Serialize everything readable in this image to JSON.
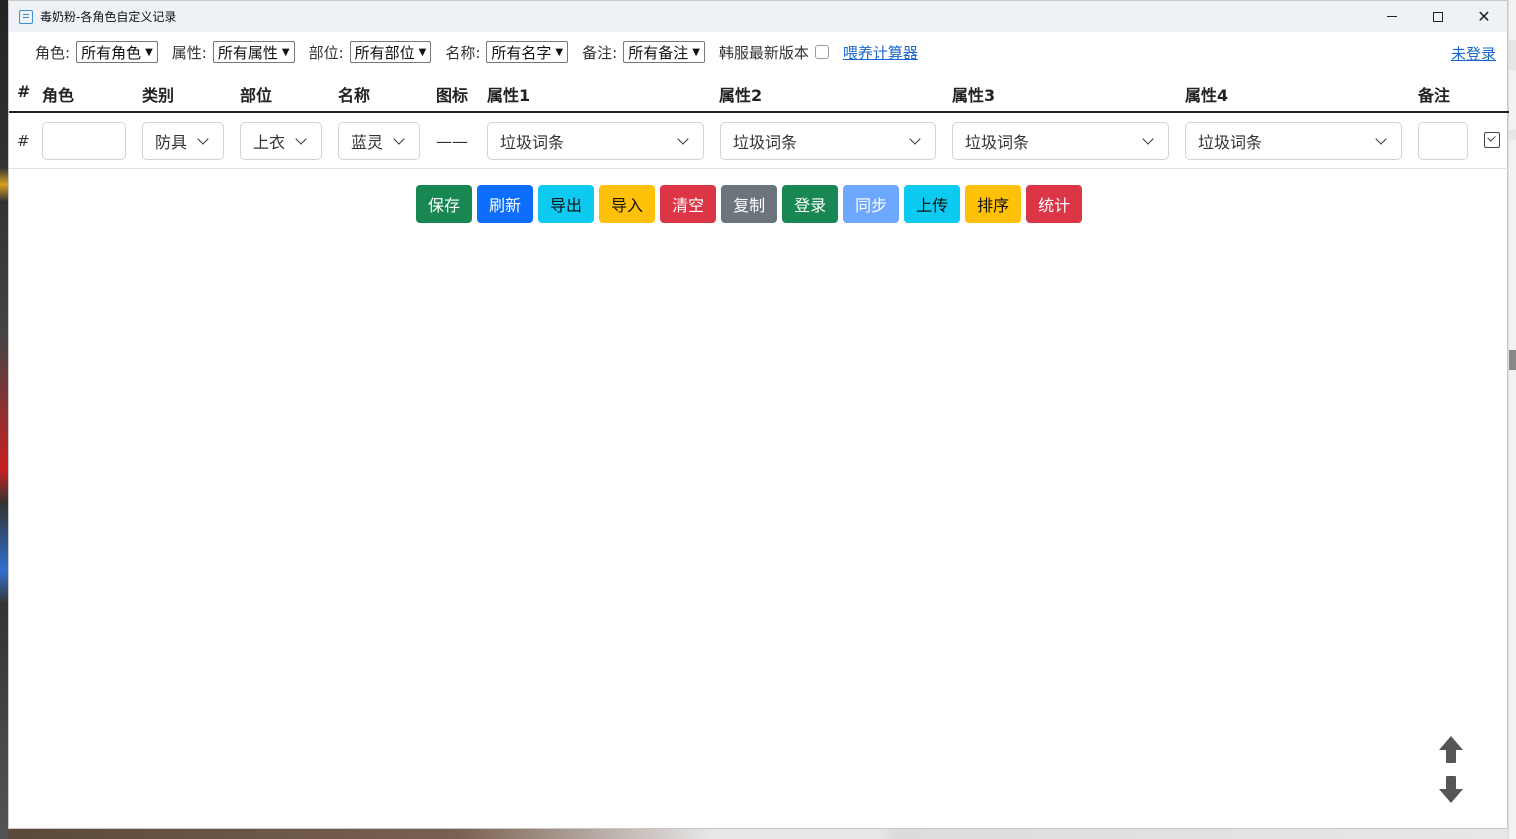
{
  "window": {
    "title": "毒奶粉-各角色自定义记录",
    "controls": {
      "minimize": "minimize-icon",
      "maximize": "maximize-icon",
      "close": "close-icon"
    }
  },
  "filters": {
    "role_label": "角色:",
    "role_value": "所有角色",
    "attr_label": "属性:",
    "attr_value": "所有属性",
    "part_label": "部位:",
    "part_value": "所有部位",
    "name_label": "名称:",
    "name_value": "所有名字",
    "note_label": "备注:",
    "note_value": "所有备注",
    "kr_label": "韩服最新版本",
    "calc_link": "喂养计算器",
    "login_link": "未登录"
  },
  "table": {
    "headers": {
      "index": "#",
      "role": "角色",
      "category": "类别",
      "part": "部位",
      "name": "名称",
      "icon": "图标",
      "attr1": "属性1",
      "attr2": "属性2",
      "attr3": "属性3",
      "attr4": "属性4",
      "note": "备注"
    },
    "row": {
      "index": "#",
      "role": "",
      "category": "防具",
      "part": "上衣",
      "name": "蓝灵",
      "icon": "——",
      "attr1": "垃圾词条",
      "attr2": "垃圾词条",
      "attr3": "垃圾词条",
      "attr4": "垃圾词条",
      "note": ""
    }
  },
  "actions": [
    {
      "label": "保存",
      "color": "#198754"
    },
    {
      "label": "刷新",
      "color": "#0d6efd"
    },
    {
      "label": "导出",
      "color": "#0dcaf0"
    },
    {
      "label": "导入",
      "color": "#ffc107"
    },
    {
      "label": "清空",
      "color": "#dc3545"
    },
    {
      "label": "复制",
      "color": "#6c757d"
    },
    {
      "label": "登录",
      "color": "#198754"
    },
    {
      "label": "同步",
      "color": "#6ea8fe"
    },
    {
      "label": "上传",
      "color": "#0dcaf0"
    },
    {
      "label": "排序",
      "color": "#ffc107"
    },
    {
      "label": "统计",
      "color": "#dc3545"
    }
  ]
}
